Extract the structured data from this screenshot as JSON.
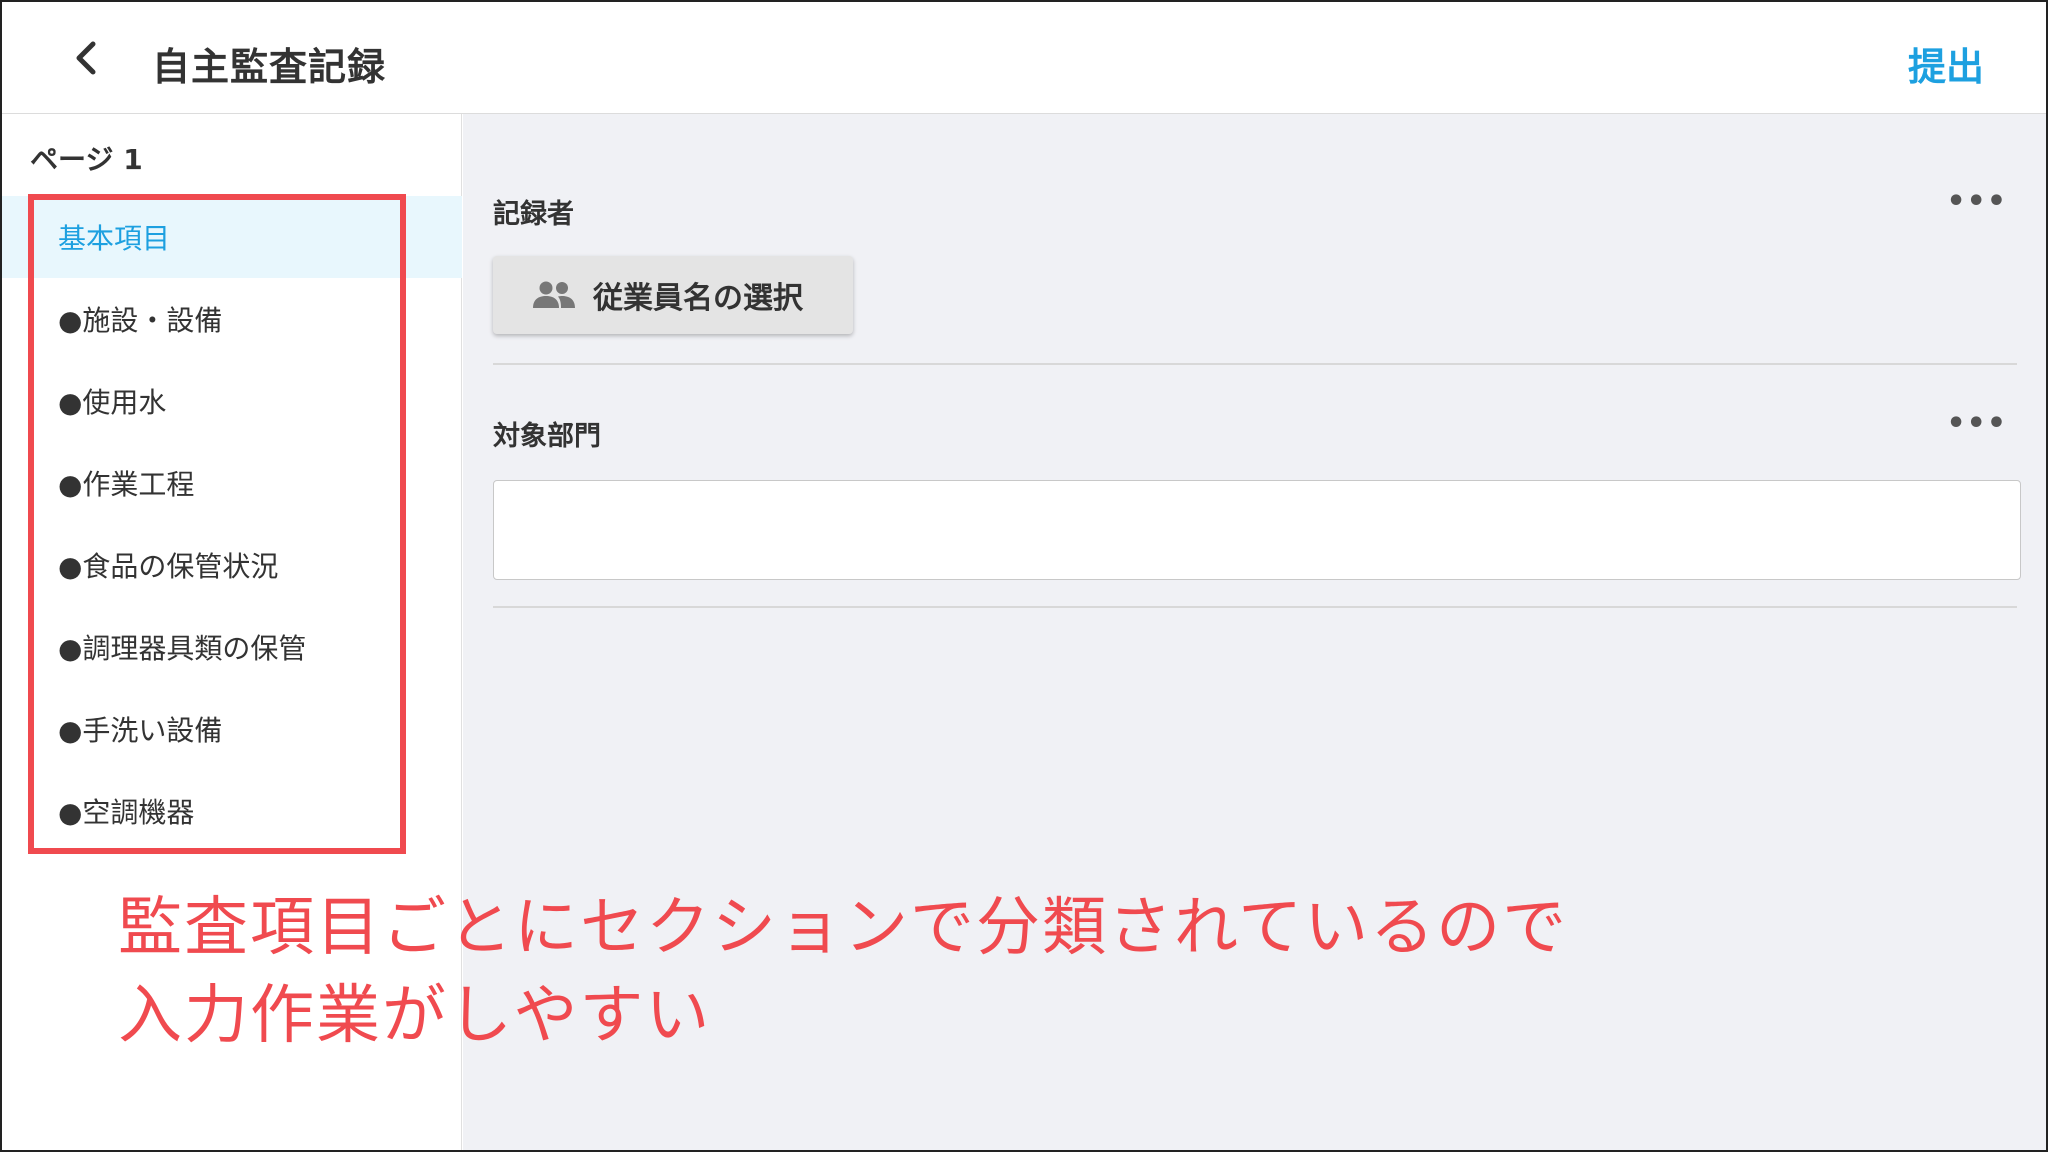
{
  "header": {
    "title": "自主監査記録",
    "submit_label": "提出",
    "accent_color": "#1da0e0"
  },
  "sidebar": {
    "page_label": "ページ 1",
    "items": [
      {
        "label": "基本項目",
        "active": true
      },
      {
        "label": "●施設・設備"
      },
      {
        "label": "●使用水"
      },
      {
        "label": "●作業工程"
      },
      {
        "label": "●食品の保管状況"
      },
      {
        "label": "●調理器具類の保管"
      },
      {
        "label": "●手洗い設備"
      },
      {
        "label": "●空調機器"
      }
    ]
  },
  "main": {
    "recorder": {
      "label": "記録者",
      "button_label": "従業員名の選択",
      "button_icon": "people-icon",
      "menu_icon": "more-horizontal-icon"
    },
    "department": {
      "label": "対象部門",
      "value": "",
      "menu_icon": "more-horizontal-icon"
    }
  },
  "annotation": {
    "line1": "監査項目ごとにセクションで分類されているので",
    "line2": "入力作業がしやすい",
    "color": "#f04a4f"
  }
}
